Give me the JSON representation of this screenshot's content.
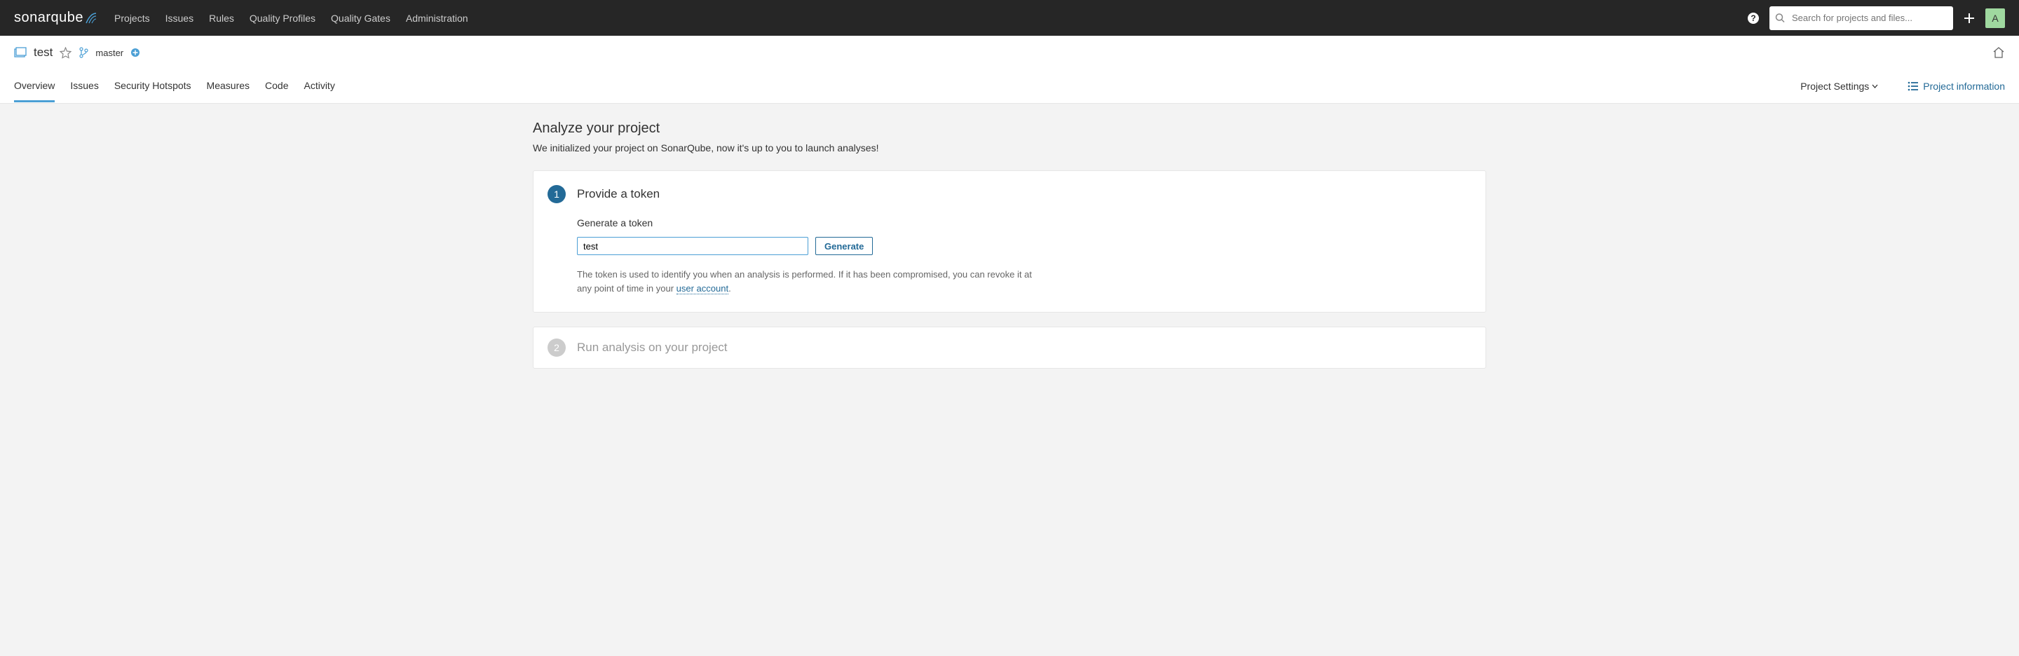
{
  "brand": "sonarqube",
  "topnav": {
    "projects": "Projects",
    "issues": "Issues",
    "rules": "Rules",
    "quality_profiles": "Quality Profiles",
    "quality_gates": "Quality Gates",
    "administration": "Administration"
  },
  "search": {
    "placeholder": "Search for projects and files..."
  },
  "avatar_initial": "A",
  "project": {
    "name": "test",
    "branch": "master"
  },
  "tabs": {
    "overview": "Overview",
    "issues": "Issues",
    "security_hotspots": "Security Hotspots",
    "measures": "Measures",
    "code": "Code",
    "activity": "Activity"
  },
  "project_settings_label": "Project Settings",
  "project_info_label": "Project information",
  "page": {
    "title": "Analyze your project",
    "subtitle": "We initialized your project on SonarQube, now it's up to you to launch analyses!"
  },
  "step1": {
    "number": "1",
    "title": "Provide a token",
    "gen_label": "Generate a token",
    "input_value": "test",
    "gen_button": "Generate",
    "help_prefix": "The token is used to identify you when an analysis is performed. If it has been compromised, you can revoke it at any point of time in your ",
    "help_link": "user account",
    "help_suffix": "."
  },
  "step2": {
    "number": "2",
    "title": "Run analysis on your project"
  }
}
